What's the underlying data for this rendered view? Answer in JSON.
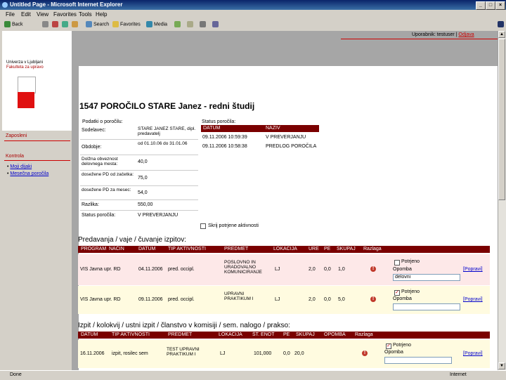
{
  "window": {
    "title": "Untitled Page - Microsoft Internet Explorer",
    "btn_min": "_",
    "btn_max": "□",
    "btn_close": "×"
  },
  "menu": [
    "File",
    "Edit",
    "View",
    "Favorites",
    "Tools",
    "Help"
  ],
  "toolbar": {
    "back": "Back",
    "search": "Search",
    "favorites": "Favorites",
    "media": "Media"
  },
  "userbar": {
    "user_label": "Uporabnik: ",
    "user": "testuser",
    "logout": "Odjava"
  },
  "sidebar": {
    "logo_line1": "Univerza v Ljubljani",
    "logo_line2": "Fakulteta za upravo",
    "section1": "Zaposleni",
    "section2": "Kontrola",
    "items": [
      "Moji dijaki",
      "Mesečna poročila"
    ]
  },
  "page": {
    "title": "1547 POROČILO STARE Janez - redni študij"
  },
  "report_data": {
    "heading": "Podatki o poročilu:",
    "fields": [
      {
        "label": "Sodelavec:",
        "value": "STARE JANEZ STARE, dipl. predavatelj"
      },
      {
        "label": "Obdobje:",
        "value": "od 01.10.06 do 31.01.06"
      },
      {
        "label": "Dolžna obveznost delovnega mesta:",
        "value": "40,0"
      },
      {
        "label": "dosežene PD od začetka:",
        "value": "75,0"
      },
      {
        "label": "dosežene PD za mesec:",
        "value": "54,0"
      },
      {
        "label": "Razlika:",
        "value": "550,00"
      },
      {
        "label": "Status poročila:",
        "value": "V PREVERJANJU"
      }
    ]
  },
  "status": {
    "heading": "Status poročila:",
    "col_date": "DATUM",
    "col_name": "NAZIV",
    "rows": [
      {
        "date": "09.11.2006 10:59:39",
        "name": "V PREVERJANJU"
      },
      {
        "date": "09.11.2006 10:58:38",
        "name": "PREDLOG POROČILA"
      }
    ]
  },
  "hide_label": "Skrij potrjene aktivnosti",
  "lectures": {
    "title": "Predavanja / vaje / čuvanje izpitov:",
    "headers": [
      "PROGRAM",
      "NAČIN",
      "DATUM",
      "TIP AKTIVNOSTI",
      "PREDMET",
      "LOKACIJA",
      "URE",
      "PE",
      "SKUPAJ",
      "Razlaga"
    ],
    "rows": [
      {
        "program": "VIS Javna upr. RD",
        "date": "04.11.2006",
        "type": "pred. occipl.",
        "subject": "POSLOVNO IN URADOVALNO KOMUNICIRANJE",
        "loc": "LJ",
        "ure": "2,0",
        "pe": "0,0",
        "total": "1,0",
        "confirm": "Potrjeno",
        "note_label": "Opomba",
        "note": "delovni",
        "action": "[Popravi]",
        "checked": false
      },
      {
        "program": "VIS Javna upr. RD",
        "date": "09.11.2006",
        "type": "pred. occipl.",
        "subject": "UPRAVNI PRAKTIKUM I",
        "loc": "LJ",
        "ure": "2,0",
        "pe": "0,0",
        "total": "5,0",
        "confirm": "Potrjeno",
        "note_label": "Opomba",
        "note": "",
        "action": "[Popravi]",
        "checked": true
      }
    ]
  },
  "exams": {
    "title": "Izpit / kolokvij / ustni izpit / članstvo v komisiji / sem. nalogo / prakso:",
    "headers": [
      "DATUM",
      "TIP AKTIVNOSTI",
      "PREDMET",
      "LOKACIJA",
      "ŠT. ENOT",
      "PE",
      "SKUPAJ",
      "OPOMBA",
      "Razlaga"
    ],
    "rows": [
      {
        "date": "16.11.2006",
        "type": "izpit, rosilec sem",
        "subject": "TEST UPRAVNI PRAKTIKUM I",
        "loc": "LJ",
        "units": "101,000",
        "pe": "0,0",
        "total": "20,0",
        "confirm": "Potrjeno",
        "note_label": "Opomba",
        "action": "[Popravi]",
        "checked": true
      }
    ]
  },
  "statusbar": {
    "left": "Done",
    "zone": "Internet"
  },
  "colors": {
    "header": "#7a0000",
    "row_pink": "#fde8e8",
    "row_yellow": "#fffbe0",
    "accent": "#cc0000"
  }
}
